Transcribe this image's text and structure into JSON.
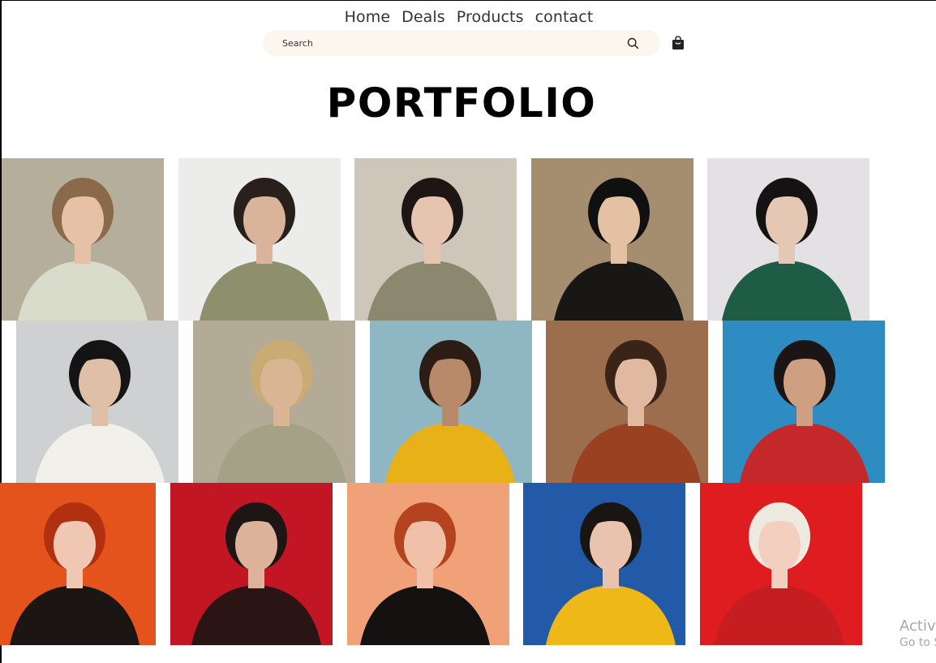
{
  "nav": {
    "home": "Home",
    "deals": "Deals",
    "products": "Products",
    "contact": "contact"
  },
  "search": {
    "placeholder": "Search",
    "icon": "search-icon"
  },
  "cart": {
    "icon": "shopping-bag-icon"
  },
  "page_title": "PORTFOLIO",
  "portfolio": {
    "rows": [
      [
        {
          "bg": "#b4ae9a",
          "clothing": "#d9dccb",
          "skin": "#e7c1a6",
          "hair": "#8a6a4a"
        },
        {
          "bg": "#ececea",
          "clothing": "#8e8f6c",
          "skin": "#d9b39a",
          "hair": "#2a201b"
        },
        {
          "bg": "#cfc6ba",
          "clothing": "#8c8870",
          "skin": "#e6c5b0",
          "hair": "#1d1613"
        },
        {
          "bg": "#a58e6f",
          "clothing": "#181716",
          "skin": "#e4c1a3",
          "hair": "#111010"
        },
        {
          "bg": "#e3e1e4",
          "clothing": "#1f5c45",
          "skin": "#e5c8b4",
          "hair": "#141212"
        }
      ],
      [
        {
          "bg": "#cfd0d2",
          "clothing": "#f2f0ea",
          "skin": "#e0bfa8",
          "hair": "#151414"
        },
        {
          "bg": "#b3ab95",
          "clothing": "#a5a186",
          "skin": "#dab594",
          "hair": "#c9ab74"
        },
        {
          "bg": "#8fb6c3",
          "clothing": "#e7b117",
          "skin": "#b98a6a",
          "hair": "#2b1c14"
        },
        {
          "bg": "#9c6e4e",
          "clothing": "#9a4121",
          "skin": "#e1b9a0",
          "hair": "#3a2418"
        },
        {
          "bg": "#2f8cc2",
          "clothing": "#c5282a",
          "skin": "#cf9f82",
          "hair": "#1b1615"
        }
      ],
      [
        {
          "bg": "#e4531b",
          "clothing": "#1b1513",
          "skin": "#efc7b2",
          "hair": "#b1300f"
        },
        {
          "bg": "#c31625",
          "clothing": "#2a1414",
          "skin": "#dcb39a",
          "hair": "#1d1615"
        },
        {
          "bg": "#f1a178",
          "clothing": "#141110",
          "skin": "#f0c0a8",
          "hair": "#b4431f"
        },
        {
          "bg": "#225aa8",
          "clothing": "#eeb818",
          "skin": "#e9c3ad",
          "hair": "#191513"
        },
        {
          "bg": "#df1c1f",
          "clothing": "#c51d20",
          "skin": "#f4cfc0",
          "hair": "#eeeae0"
        }
      ]
    ]
  },
  "watermark": {
    "line1": "Activ",
    "line2": "Go to S"
  }
}
